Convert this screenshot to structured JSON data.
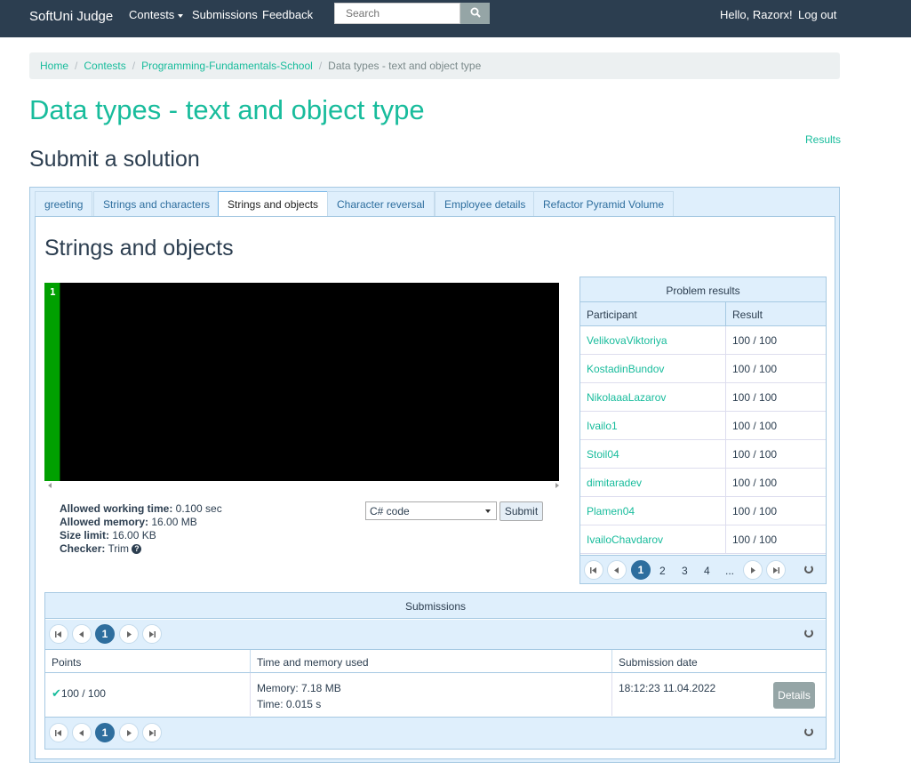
{
  "navbar": {
    "brand": "SoftUni Judge",
    "contests": "Contests",
    "submissions": "Submissions",
    "feedback": "Feedback",
    "search_placeholder": "Search",
    "greeting": "Hello, Razorx!",
    "logout": "Log out"
  },
  "breadcrumb": {
    "home": "Home",
    "contests": "Contests",
    "contest": "Programming-Fundamentals-School",
    "current": "Data types - text and object type"
  },
  "page": {
    "title": "Data types - text and object type",
    "results_link": "Results",
    "subtitle": "Submit a solution"
  },
  "tabs": [
    {
      "label": "greeting"
    },
    {
      "label": "Strings and characters"
    },
    {
      "label": "Strings and objects"
    },
    {
      "label": "Character reversal"
    },
    {
      "label": "Employee details"
    },
    {
      "label": "Refactor Pyramid Volume"
    }
  ],
  "problem": {
    "title": "Strings and objects",
    "editor_line": "1",
    "limits": {
      "time_label": "Allowed working time:",
      "time_value": " 0.100 sec",
      "memory_label": "Allowed memory:",
      "memory_value": " 16.00 MB",
      "size_label": "Size limit:",
      "size_value": " 16.00 KB",
      "checker_label": "Checker:",
      "checker_value": " Trim",
      "help": "?"
    },
    "language": "C# code",
    "submit": "Submit"
  },
  "results": {
    "header": "Problem results",
    "col_participant": "Participant",
    "col_result": "Result",
    "rows": [
      {
        "name": "VelikovaViktoriya",
        "score": "100 / 100"
      },
      {
        "name": "KostadinBundov",
        "score": "100 / 100"
      },
      {
        "name": "NikolaaaLazarov",
        "score": "100 / 100"
      },
      {
        "name": "Ivailo1",
        "score": "100 / 100"
      },
      {
        "name": "Stoil04",
        "score": "100 / 100"
      },
      {
        "name": "dimitaradev",
        "score": "100 / 100"
      },
      {
        "name": "Plamen04",
        "score": "100 / 100"
      },
      {
        "name": "IvailoChavdarov",
        "score": "100 / 100"
      }
    ],
    "pages": [
      "1",
      "2",
      "3",
      "4",
      "..."
    ]
  },
  "submissions": {
    "header": "Submissions",
    "page": "1",
    "col_points": "Points",
    "col_time_memory": "Time and memory used",
    "col_date": "Submission date",
    "row": {
      "points": "100 / 100",
      "memory": "Memory: 7.18 MB",
      "time": "Time: 0.015 s",
      "date": "18:12:23 11.04.2022",
      "details": "Details"
    }
  }
}
